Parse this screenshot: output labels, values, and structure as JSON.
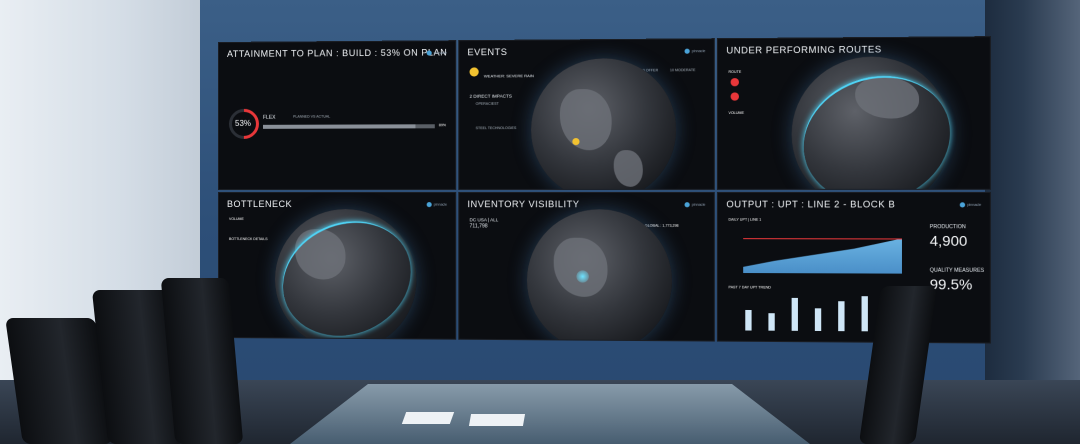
{
  "panels": {
    "attainment": {
      "title": "ATTAINMENT TO PLAN : BUILD : 53% ON PLAN",
      "gauge_value": "53%",
      "row_label": "FLEX",
      "col_header": "PLANNED VS ACTUAL",
      "row_percent": "89%",
      "progress_fraction": 0.89
    },
    "events": {
      "title": "EVENTS",
      "stats": [
        "0 OFFLINE",
        "0 OFFER",
        "10 MODERATE"
      ],
      "event_heading": "WEATHER: SEVERE RAIN",
      "section": "2 DIRECT IMPACTS",
      "item1": "OPERACIEST",
      "item2": "STEEL TECHNOLOGIES"
    },
    "routes": {
      "title": "UNDER PERFORMING ROUTES",
      "label_route": "ROUTE",
      "label_volume": "VOLUME"
    },
    "bottleneck": {
      "title": "BOTTLENECK",
      "label_volume": "VOLUME",
      "label_details": "BOTTLENECK DETAILS"
    },
    "inventory": {
      "title": "INVENTORY VISIBILITY",
      "location": "DC USA | ALL",
      "value": "711,798",
      "global": "GLOBAL : 1,773,298"
    },
    "output": {
      "title": "OUTPUT : UPT : LINE 2 - BLOCK B",
      "daily_label": "DAILY UPT | LINE 1",
      "trend_label": "PAST 7 DAY UPT TREND",
      "production_label": "PRODUCTION",
      "production_value": "4,900",
      "quality_label": "QUALITY MEASURES",
      "quality_value": "99.5%",
      "trend_values": [
        0.55,
        0.48,
        0.9,
        0.62,
        0.8,
        0.95,
        0.7
      ]
    }
  },
  "colors": {
    "accent_cyan": "#4fd3f5",
    "accent_red": "#e8373a",
    "wall_blue": "#2d4f78"
  }
}
